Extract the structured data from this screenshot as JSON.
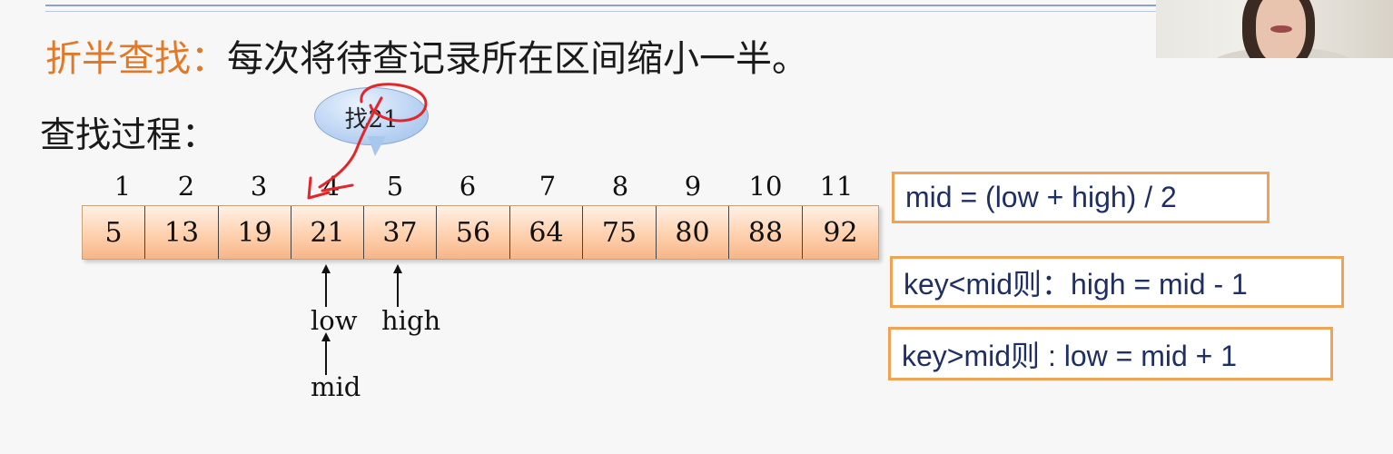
{
  "title": {
    "keyword": "折半查找：",
    "text": "每次将待查记录所在区间缩小一半。"
  },
  "subtitle": "查找过程：",
  "bubble": "找21",
  "indices": [
    "1",
    "2",
    "3",
    "4",
    "5",
    "6",
    "7",
    "8",
    "9",
    "10",
    "11"
  ],
  "values": [
    "5",
    "13",
    "19",
    "21",
    "37",
    "56",
    "64",
    "75",
    "80",
    "88",
    "92"
  ],
  "pointers": {
    "low": "low",
    "high": "high",
    "mid": "mid"
  },
  "rules": {
    "mid": "mid = (low + high) / 2",
    "less": "key<mid则：high = mid - 1",
    "greater": "key>mid则 : low = mid + 1"
  },
  "colors": {
    "keyword": "#e07a28",
    "rule_border": "#f0a255",
    "rule_text": "#1f2f63",
    "annotation": "#e3262a"
  }
}
